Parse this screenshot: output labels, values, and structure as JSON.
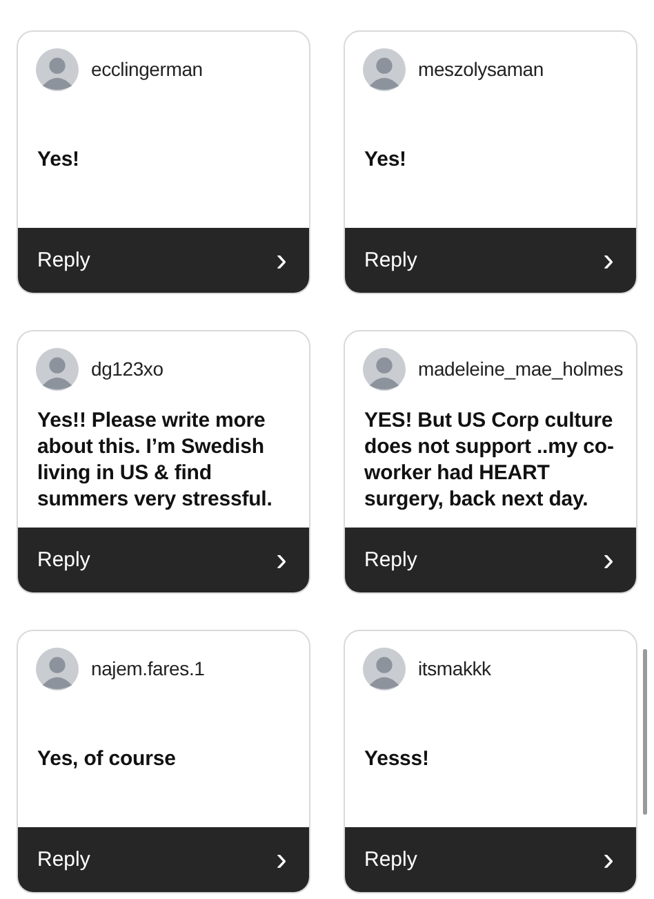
{
  "comments": [
    {
      "username": "ecclingerman",
      "message": "Yes!",
      "reply_label": "Reply",
      "reply_icon": "›"
    },
    {
      "username": "meszolysaman",
      "message": "Yes!",
      "reply_label": "Reply",
      "reply_icon": "›"
    },
    {
      "username": "dg123xo",
      "message": "Yes!! Please write more about this. I’m Swedish living in US & find summers very stressful.",
      "reply_label": "Reply",
      "reply_icon": "›"
    },
    {
      "username": "madeleine_mae_holmes",
      "message": "YES! But US Corp culture does not support ..my co-worker had HEART surgery, back next day.",
      "reply_label": "Reply",
      "reply_icon": "›"
    },
    {
      "username": "najem.fares.1",
      "message": "Yes, of course",
      "reply_label": "Reply",
      "reply_icon": "›"
    },
    {
      "username": "itsmakkk",
      "message": "Yesss!",
      "reply_label": "Reply",
      "reply_icon": "›"
    }
  ]
}
